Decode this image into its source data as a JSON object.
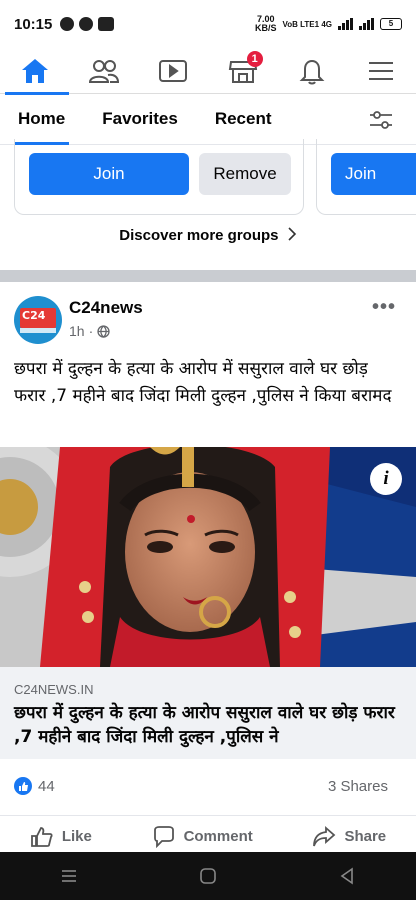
{
  "status_bar": {
    "time": "10:15",
    "speed_value": "7.00",
    "speed_unit": "KB/S",
    "network": "VoB LTE1 4G",
    "battery": "5"
  },
  "nav": {
    "items": [
      {
        "icon": "home-icon",
        "active": true
      },
      {
        "icon": "friends-icon"
      },
      {
        "icon": "watch-icon"
      },
      {
        "icon": "marketplace-icon",
        "badge": "1"
      },
      {
        "icon": "bell-icon"
      },
      {
        "icon": "menu-icon"
      }
    ]
  },
  "feed_tabs": {
    "home": "Home",
    "favorites": "Favorites",
    "recent": "Recent"
  },
  "groups": {
    "join_label": "Join",
    "remove_label": "Remove",
    "join_label_2": "Join",
    "discover_label": "Discover more groups"
  },
  "post": {
    "page_name": "C24news",
    "time": "1h",
    "text": "छपरा में दुल्हन के हत्या के आरोप में ससुराल वाले घर छोड़ फरार ,7  महीने बाद जिंदा मिली दुल्हन ,पुलिस ने किया बरामद",
    "info_label": "i",
    "link": {
      "domain": "C24NEWS.IN",
      "title": "छपरा में दुल्हन के हत्या के आरोप ससुराल वाले घर छोड़ फरार ,7 महीने बाद जिंदा मिली दुल्हन ,पुलिस ने"
    },
    "likes": "44",
    "shares": "3 Shares",
    "actions": {
      "like": "Like",
      "comment": "Comment",
      "share": "Share"
    }
  },
  "colors": {
    "accent": "#1877f2",
    "badge": "#e41e3f",
    "secondary_text": "#65676b"
  }
}
